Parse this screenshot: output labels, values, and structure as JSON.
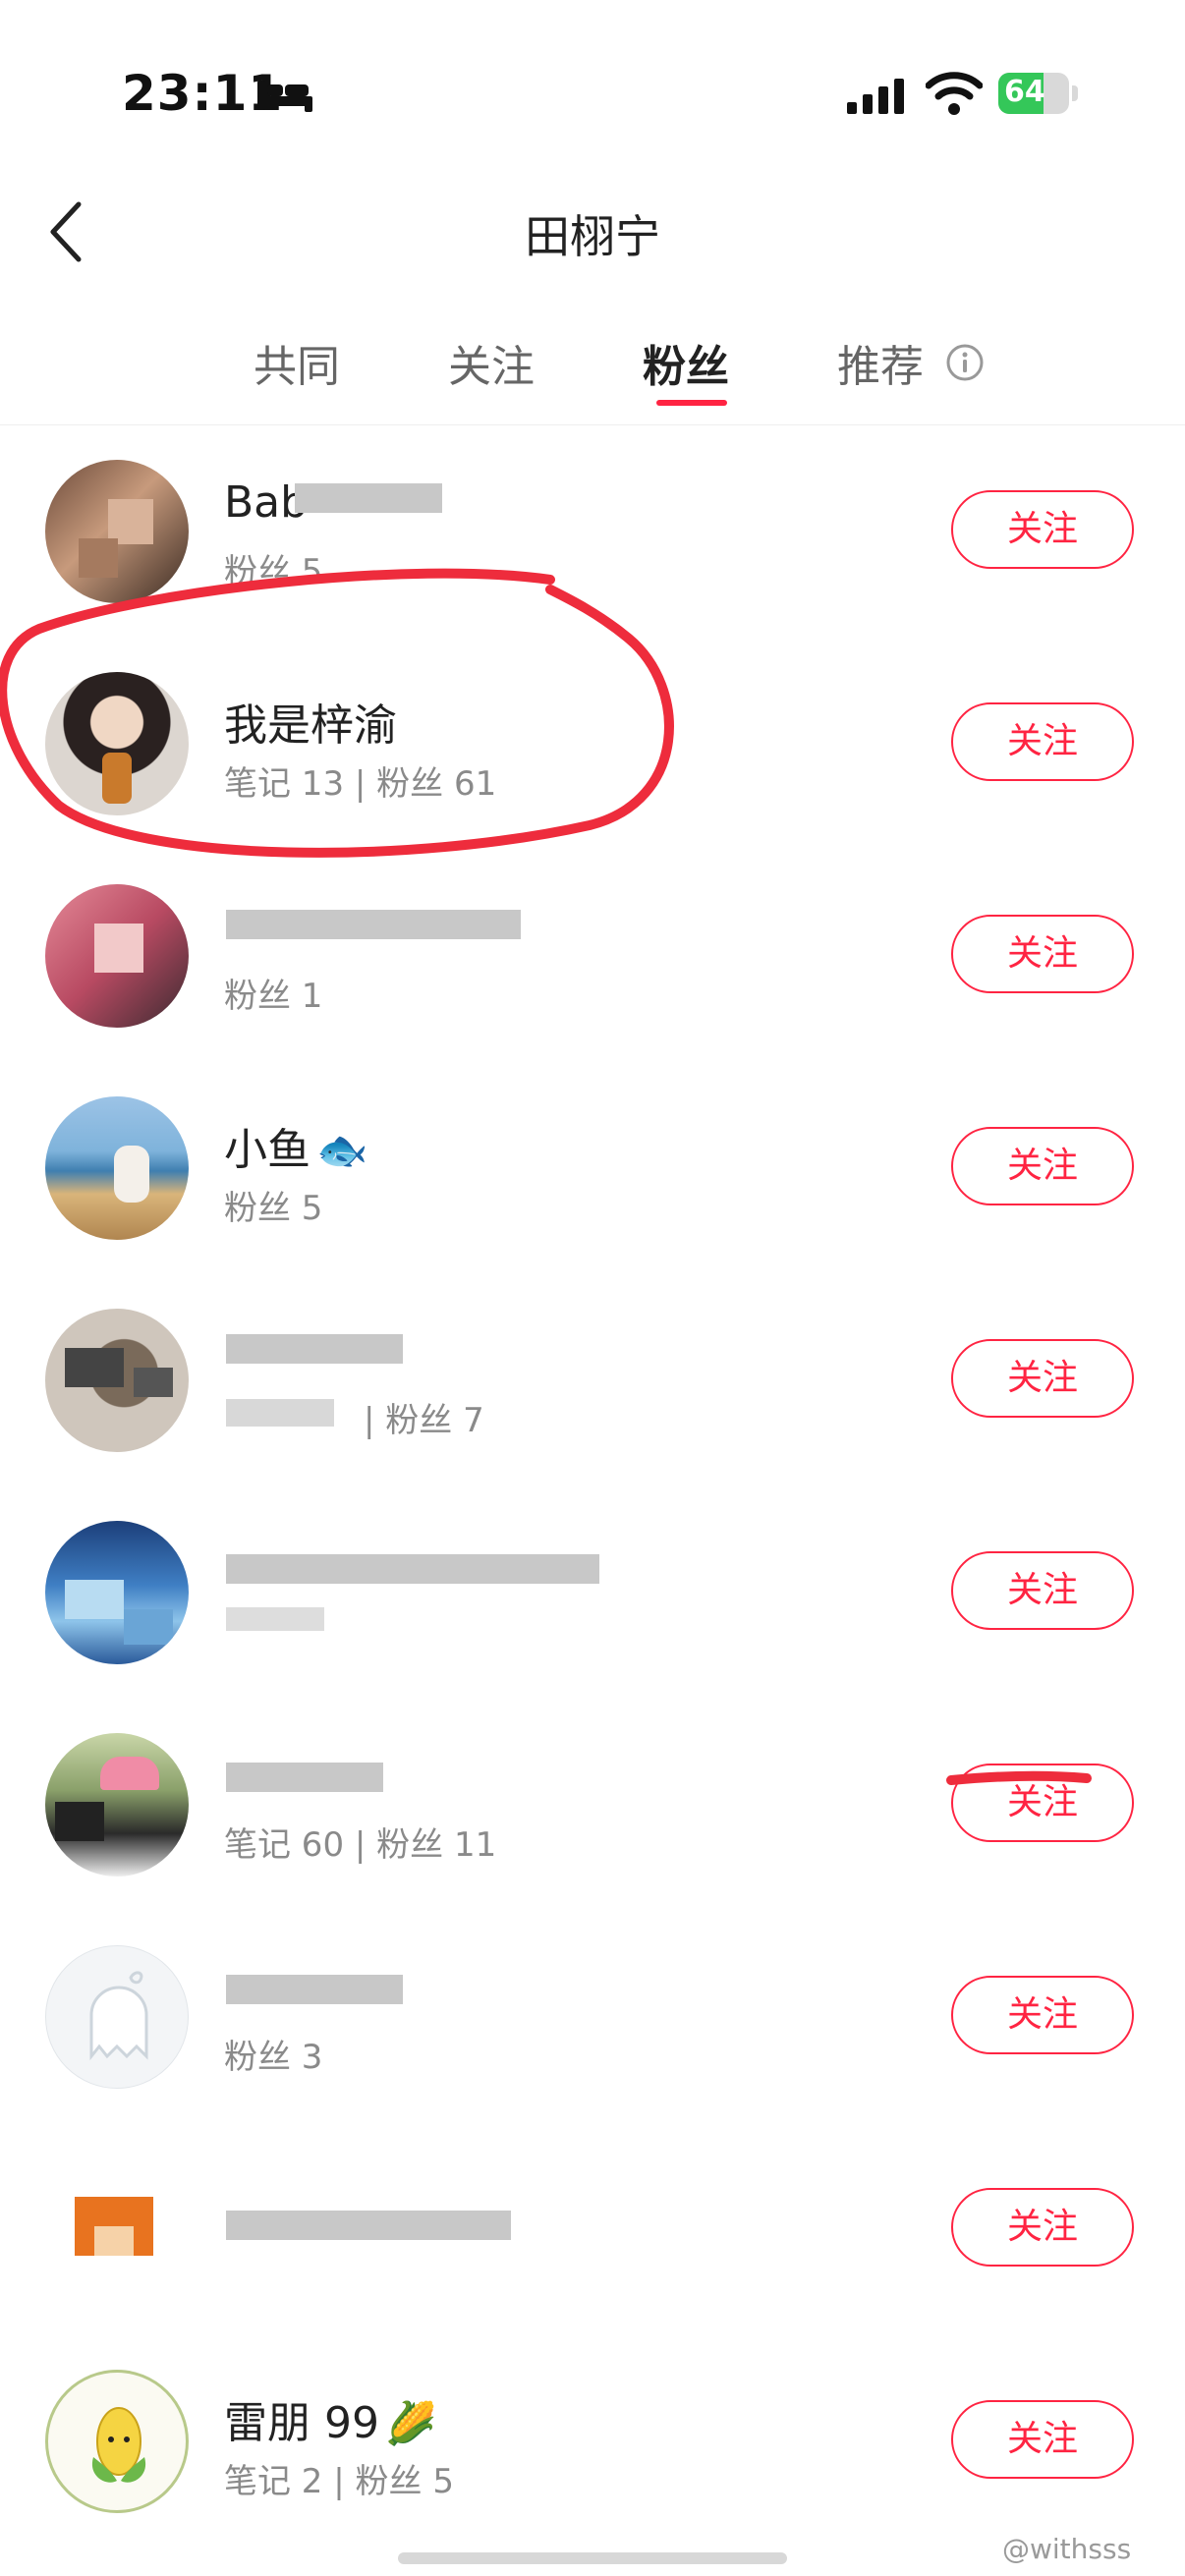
{
  "status_bar": {
    "time": "23:11",
    "battery": "64",
    "battery_level": 0.64
  },
  "nav": {
    "title": "田栩宁"
  },
  "tabs": [
    {
      "label": "共同"
    },
    {
      "label": "关注"
    },
    {
      "label": "粉丝"
    },
    {
      "label": "推荐"
    }
  ],
  "active_tab": "粉丝",
  "accent_color": "#ff2442",
  "follow_label": "关注",
  "followers": [
    {
      "name": "Bab",
      "meta": "粉丝 5"
    },
    {
      "name": "我是梓渝",
      "meta": "笔记 13 | 粉丝 61"
    },
    {
      "name": "",
      "meta": "粉丝 1"
    },
    {
      "name": "小鱼",
      "name_emoji": "🐟",
      "meta": "粉丝 5"
    },
    {
      "name": "",
      "meta": "| 粉丝 7"
    },
    {
      "name": "",
      "meta": ""
    },
    {
      "name": "",
      "meta": "笔记 60 | 粉丝 11"
    },
    {
      "name": "",
      "meta": "粉丝 3"
    },
    {
      "name": "",
      "meta": ""
    },
    {
      "name": "雷朋 99",
      "name_emoji": "🌽",
      "meta": "笔记 2 | 粉丝 5"
    }
  ],
  "watermark": "@withsss"
}
